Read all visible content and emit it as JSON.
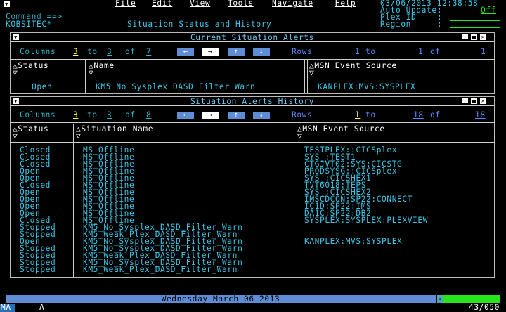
{
  "menu": [
    "File",
    "Edit",
    "View",
    "Tools",
    "Navigate",
    "Help"
  ],
  "datetime": "03/06/2013 12:38:58",
  "command_label": "Command ==>",
  "auto_update_label": "Auto Update",
  "auto_update_value": "Off",
  "node_name": "KOBSITEC*",
  "screen_title": "Situation Status and History",
  "plex_id_label": "Plex ID",
  "region_label": "Region",
  "current": {
    "title": "Current Situation Alerts",
    "columns_label": "Columns",
    "col_from": "3",
    "col_to_label": "to",
    "col_to": "3",
    "col_of_label": "of",
    "col_total": "7",
    "rows_label": "Rows",
    "row_from": "1",
    "row_to_label": "to",
    "row_to": "1",
    "row_of_label": "of",
    "row_total": "1",
    "headers": [
      "Status",
      "Name",
      "MSN Event Source"
    ],
    "rows": [
      {
        "status": "Open",
        "name": "KM5_No_Sysplex_DASD_Filter_Warn",
        "source": "KANPLEX:MVS:SYSPLEX"
      }
    ]
  },
  "history": {
    "title": "Situation Alerts History",
    "columns_label": "Columns",
    "col_from": "3",
    "col_to_label": "to",
    "col_to": "3",
    "col_of_label": "of",
    "col_total": "8",
    "rows_label": "Rows",
    "row_from": "1",
    "row_to_label": "to",
    "row_to": "18",
    "row_of_label": "of",
    "row_total": "18",
    "headers": [
      "Status",
      "Situation Name",
      "MSN Event Source"
    ],
    "rows": [
      {
        "status": "Closed",
        "name": "MS_Offline",
        "source": "TESTPLEX::CICSplex"
      },
      {
        "status": "Closed",
        "name": "MS_Offline",
        "source": "SYS_:TEST1"
      },
      {
        "status": "Closed",
        "name": "MS_Offline",
        "source": "CTGJVT02:SYS:CICSTG"
      },
      {
        "status": "Open",
        "name": "MS_Offline",
        "source": "PRODSYSG::CICSplex"
      },
      {
        "status": "Open",
        "name": "MS_Offline",
        "source": "SYS_:CICSHEX1"
      },
      {
        "status": "Closed",
        "name": "MS_Offline",
        "source": "TVT6018:TEPS"
      },
      {
        "status": "Open",
        "name": "MS_Offline",
        "source": "SYS_:CICSHEX2"
      },
      {
        "status": "Open",
        "name": "MS_Offline",
        "source": "IMSCDCON:SP22:CONNECT"
      },
      {
        "status": "Open",
        "name": "MS_Offline",
        "source": "IC1D:SP22:IMS"
      },
      {
        "status": "Open",
        "name": "MS_Offline",
        "source": "DA1C:SP22:DB2"
      },
      {
        "status": "Closed",
        "name": "MS_Offline",
        "source": "SYSPLEX:SYSPLEX:PLEXVIEW"
      },
      {
        "status": "Stopped",
        "name": "KM5_No_Sysplex_DASD_Filter_Warn",
        "source": ""
      },
      {
        "status": "Stopped",
        "name": "KM5_Weak_Plex_DASD_Filter_Warn",
        "source": ""
      },
      {
        "status": "Open",
        "name": "KM5_No_Sysplex_DASD_Filter_Warn",
        "source": "KANPLEX:MVS:SYSPLEX"
      },
      {
        "status": "Stopped",
        "name": "KM5_No_Sysplex_DASD_Filter_Warn",
        "source": ""
      },
      {
        "status": "Stopped",
        "name": "KM5_Weak_Plex_DASD_Filter_Warn",
        "source": ""
      },
      {
        "status": "Stopped",
        "name": "KM5_No_Sysplex_DASD_Filter_Warn",
        "source": ""
      },
      {
        "status": "Stopped",
        "name": "KM5_Weak_Plex_DASD_Filter_Warn",
        "source": ""
      }
    ]
  },
  "status_date": "Wednesday March 06 2013",
  "oia_left": "MA",
  "oia_mode": "A",
  "cursor_pos": "43/050",
  "colors": {
    "cyan": "#3ec5e6",
    "green": "#27e51c",
    "blue": "#5c8cff",
    "bar": "#5f8dd5"
  }
}
